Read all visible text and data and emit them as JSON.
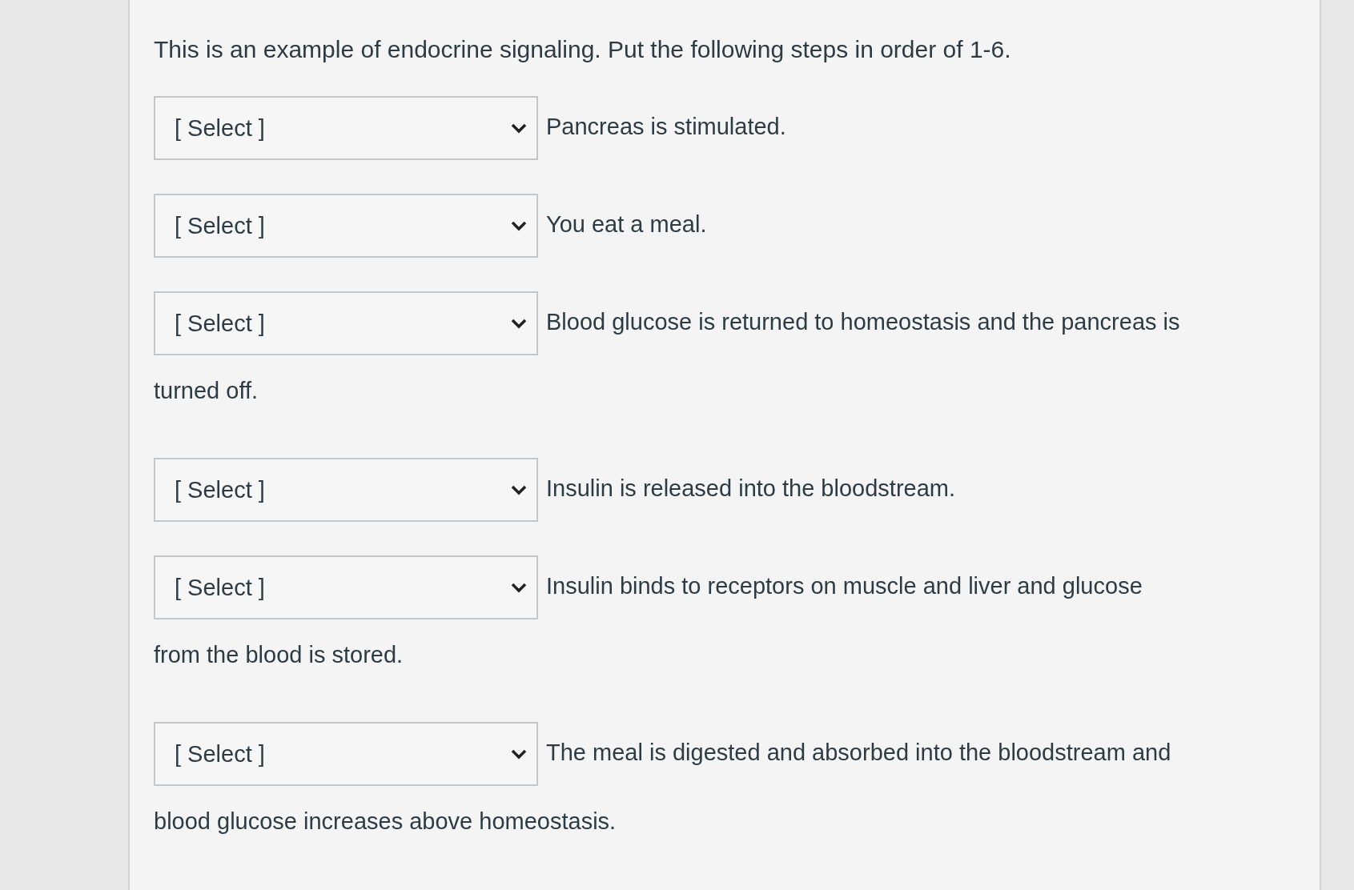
{
  "question": "This is an example of endocrine signaling. Put the following steps  in order of 1-6.",
  "steps": [
    {
      "select": "[ Select ]",
      "lines": [
        "Pancreas is stimulated."
      ]
    },
    {
      "select": "[ Select ]",
      "lines": [
        "You eat a meal."
      ]
    },
    {
      "select": "[ Select ]",
      "lines": [
        "Blood glucose is returned to homeostasis and the pancreas is",
        "turned off."
      ]
    },
    {
      "select": "[ Select ]",
      "lines": [
        "Insulin is released into the bloodstream."
      ]
    },
    {
      "select": "[ Select ]",
      "lines": [
        "Insulin binds to receptors on muscle and liver and glucose",
        "from the blood is stored."
      ]
    },
    {
      "select": "[ Select ]",
      "lines": [
        "The meal is digested and absorbed into the bloodstream and",
        "blood glucose increases above homeostasis."
      ]
    }
  ]
}
